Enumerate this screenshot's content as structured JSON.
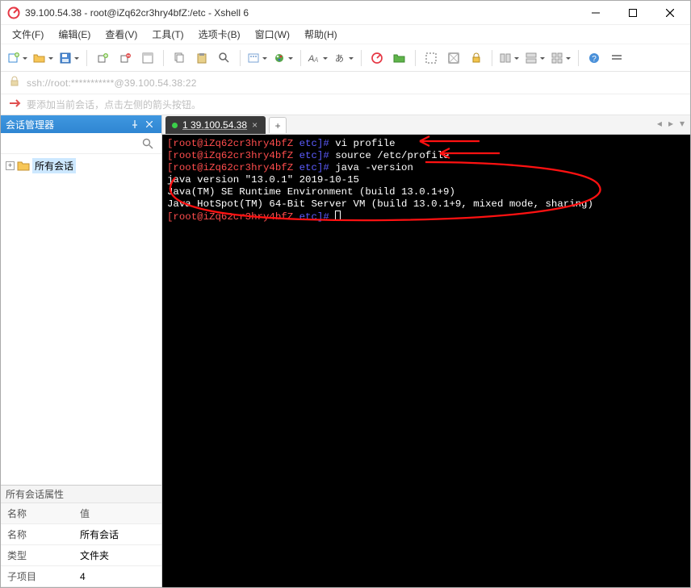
{
  "titlebar": {
    "title": "39.100.54.38 - root@iZq62cr3hry4bfZ:/etc - Xshell 6"
  },
  "menubar": {
    "items": [
      "文件(F)",
      "编辑(E)",
      "查看(V)",
      "工具(T)",
      "选项卡(B)",
      "窗口(W)",
      "帮助(H)"
    ]
  },
  "addrbar": {
    "text": "ssh://root:***********@39.100.54.38:22"
  },
  "hintbar": {
    "text": "要添加当前会话，点击左侧的箭头按钮。"
  },
  "sidebar": {
    "title": "会话管理器",
    "tree_item": "所有会话",
    "props_title": "所有会话属性",
    "props_headers": [
      "名称",
      "值"
    ],
    "rows": [
      {
        "k": "名称",
        "v": "所有会话"
      },
      {
        "k": "类型",
        "v": "文件夹"
      },
      {
        "k": "子项目",
        "v": "4"
      }
    ]
  },
  "doctabs": {
    "active": "1 39.100.54.38"
  },
  "terminal": {
    "lines": [
      {
        "prompt_a": "[root@iZq62cr3hry4bfZ ",
        "prompt_b": "etc]# ",
        "cmd": "vi profile"
      },
      {
        "prompt_a": "[root@iZq62cr3hry4bfZ ",
        "prompt_b": "etc]# ",
        "cmd": "source /etc/profile"
      },
      {
        "prompt_a": "[root@iZq62cr3hry4bfZ ",
        "prompt_b": "etc]# ",
        "cmd": "java -version"
      },
      {
        "out": "java version \"13.0.1\" 2019-10-15"
      },
      {
        "out": "Java(TM) SE Runtime Environment (build 13.0.1+9)"
      },
      {
        "out": "Java HotSpot(TM) 64-Bit Server VM (build 13.0.1+9, mixed mode, sharing)"
      },
      {
        "prompt_a": "[root@iZq62cr3hry4bfZ ",
        "prompt_b": "etc]# ",
        "cmd": ""
      }
    ]
  }
}
